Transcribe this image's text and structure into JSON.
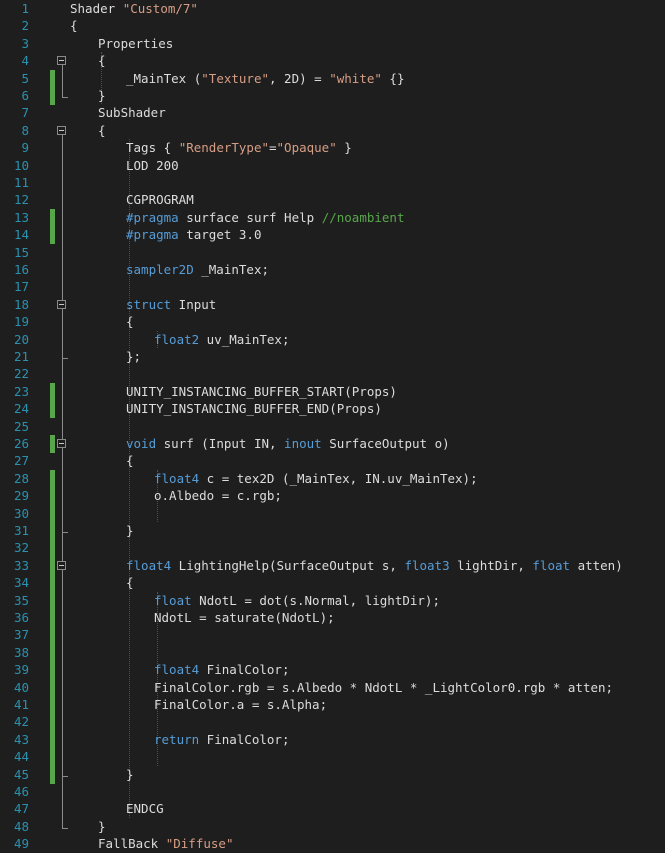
{
  "theme": {
    "background": "#1e1e1e",
    "line_number": "#2b91af",
    "text": "#dcdcdc",
    "keyword": "#569cd6",
    "string": "#d69d85",
    "comment": "#57a64a",
    "change_marker": "#57a64a"
  },
  "icons": {
    "fold": "collapse-minus-icon"
  },
  "lines": [
    {
      "n": "1",
      "changed": false,
      "fold": false,
      "indent": 0,
      "tokens": [
        [
          "txt",
          "Shader "
        ],
        [
          "str",
          "\"Custom/7\""
        ]
      ]
    },
    {
      "n": "2",
      "changed": false,
      "fold": false,
      "indent": 0,
      "tokens": [
        [
          "txt",
          "{"
        ]
      ]
    },
    {
      "n": "3",
      "changed": false,
      "fold": false,
      "indent": 4,
      "tokens": [
        [
          "txt",
          "Properties"
        ]
      ]
    },
    {
      "n": "4",
      "changed": false,
      "fold": true,
      "indent": 4,
      "tokens": [
        [
          "txt",
          "{"
        ]
      ]
    },
    {
      "n": "5",
      "changed": true,
      "fold": false,
      "indent": 8,
      "tokens": [
        [
          "txt",
          "_MainTex ("
        ],
        [
          "str",
          "\"Texture\""
        ],
        [
          "txt",
          ", 2D) = "
        ],
        [
          "str",
          "\"white\""
        ],
        [
          "txt",
          " {}"
        ]
      ]
    },
    {
      "n": "6",
      "changed": true,
      "fold": false,
      "indent": 4,
      "tokens": [
        [
          "txt",
          "}"
        ]
      ]
    },
    {
      "n": "7",
      "changed": false,
      "fold": false,
      "indent": 4,
      "tokens": [
        [
          "txt",
          "SubShader"
        ]
      ]
    },
    {
      "n": "8",
      "changed": false,
      "fold": true,
      "indent": 4,
      "tokens": [
        [
          "txt",
          "{"
        ]
      ]
    },
    {
      "n": "9",
      "changed": false,
      "fold": false,
      "indent": 8,
      "tokens": [
        [
          "txt",
          "Tags { "
        ],
        [
          "str",
          "\"RenderType\""
        ],
        [
          "txt",
          "="
        ],
        [
          "str",
          "\"Opaque\""
        ],
        [
          "txt",
          " }"
        ]
      ]
    },
    {
      "n": "10",
      "changed": false,
      "fold": false,
      "indent": 8,
      "tokens": [
        [
          "txt",
          "LOD 200"
        ]
      ]
    },
    {
      "n": "11",
      "changed": false,
      "fold": false,
      "indent": 0,
      "tokens": []
    },
    {
      "n": "12",
      "changed": false,
      "fold": false,
      "indent": 8,
      "tokens": [
        [
          "txt",
          "CGPROGRAM"
        ]
      ]
    },
    {
      "n": "13",
      "changed": true,
      "fold": false,
      "indent": 8,
      "tokens": [
        [
          "kw",
          "#pragma"
        ],
        [
          "txt",
          " surface surf Help "
        ],
        [
          "com",
          "//noambient"
        ]
      ]
    },
    {
      "n": "14",
      "changed": true,
      "fold": false,
      "indent": 8,
      "tokens": [
        [
          "kw",
          "#pragma"
        ],
        [
          "txt",
          " target 3.0"
        ]
      ]
    },
    {
      "n": "15",
      "changed": false,
      "fold": false,
      "indent": 0,
      "tokens": []
    },
    {
      "n": "16",
      "changed": false,
      "fold": false,
      "indent": 8,
      "tokens": [
        [
          "kw",
          "sampler2D"
        ],
        [
          "txt",
          " _MainTex;"
        ]
      ]
    },
    {
      "n": "17",
      "changed": false,
      "fold": false,
      "indent": 0,
      "tokens": []
    },
    {
      "n": "18",
      "changed": false,
      "fold": true,
      "indent": 8,
      "tokens": [
        [
          "kw",
          "struct"
        ],
        [
          "txt",
          " Input"
        ]
      ]
    },
    {
      "n": "19",
      "changed": false,
      "fold": false,
      "indent": 8,
      "tokens": [
        [
          "txt",
          "{"
        ]
      ]
    },
    {
      "n": "20",
      "changed": false,
      "fold": false,
      "indent": 12,
      "tokens": [
        [
          "kw",
          "float2"
        ],
        [
          "txt",
          " uv_MainTex;"
        ]
      ]
    },
    {
      "n": "21",
      "changed": false,
      "fold": false,
      "indent": 8,
      "tokens": [
        [
          "txt",
          "};"
        ]
      ]
    },
    {
      "n": "22",
      "changed": false,
      "fold": false,
      "indent": 0,
      "tokens": []
    },
    {
      "n": "23",
      "changed": true,
      "fold": false,
      "indent": 8,
      "tokens": [
        [
          "txt",
          "UNITY_INSTANCING_BUFFER_START(Props)"
        ]
      ]
    },
    {
      "n": "24",
      "changed": true,
      "fold": false,
      "indent": 8,
      "tokens": [
        [
          "txt",
          "UNITY_INSTANCING_BUFFER_END(Props)"
        ]
      ]
    },
    {
      "n": "25",
      "changed": false,
      "fold": false,
      "indent": 0,
      "tokens": []
    },
    {
      "n": "26",
      "changed": true,
      "fold": true,
      "indent": 8,
      "tokens": [
        [
          "kw",
          "void"
        ],
        [
          "txt",
          " surf (Input IN, "
        ],
        [
          "kw",
          "inout"
        ],
        [
          "txt",
          " SurfaceOutput o)"
        ]
      ]
    },
    {
      "n": "27",
      "changed": false,
      "fold": false,
      "indent": 8,
      "tokens": [
        [
          "txt",
          "{"
        ]
      ]
    },
    {
      "n": "28",
      "changed": true,
      "fold": false,
      "indent": 12,
      "tokens": [
        [
          "kw",
          "float4"
        ],
        [
          "txt",
          " c = tex2D (_MainTex, IN.uv_MainTex);"
        ]
      ]
    },
    {
      "n": "29",
      "changed": true,
      "fold": false,
      "indent": 12,
      "tokens": [
        [
          "txt",
          "o.Albedo = c.rgb;"
        ]
      ]
    },
    {
      "n": "30",
      "changed": true,
      "fold": false,
      "indent": 0,
      "tokens": []
    },
    {
      "n": "31",
      "changed": true,
      "fold": false,
      "indent": 8,
      "tokens": [
        [
          "txt",
          "}"
        ]
      ]
    },
    {
      "n": "32",
      "changed": true,
      "fold": false,
      "indent": 0,
      "tokens": []
    },
    {
      "n": "33",
      "changed": true,
      "fold": true,
      "indent": 8,
      "tokens": [
        [
          "kw",
          "float4"
        ],
        [
          "txt",
          " LightingHelp(SurfaceOutput s, "
        ],
        [
          "kw",
          "float3"
        ],
        [
          "txt",
          " lightDir, "
        ],
        [
          "kw",
          "float"
        ],
        [
          "txt",
          " atten)"
        ]
      ]
    },
    {
      "n": "34",
      "changed": true,
      "fold": false,
      "indent": 8,
      "tokens": [
        [
          "txt",
          "{"
        ]
      ]
    },
    {
      "n": "35",
      "changed": true,
      "fold": false,
      "indent": 12,
      "tokens": [
        [
          "kw",
          "float"
        ],
        [
          "txt",
          " NdotL = dot(s.Normal, lightDir);"
        ]
      ]
    },
    {
      "n": "36",
      "changed": true,
      "fold": false,
      "indent": 12,
      "tokens": [
        [
          "txt",
          "NdotL = saturate(NdotL);"
        ]
      ]
    },
    {
      "n": "37",
      "changed": true,
      "fold": false,
      "indent": 0,
      "tokens": []
    },
    {
      "n": "38",
      "changed": true,
      "fold": false,
      "indent": 0,
      "tokens": []
    },
    {
      "n": "39",
      "changed": true,
      "fold": false,
      "indent": 12,
      "tokens": [
        [
          "kw",
          "float4"
        ],
        [
          "txt",
          " FinalColor;"
        ]
      ]
    },
    {
      "n": "40",
      "changed": true,
      "fold": false,
      "indent": 12,
      "tokens": [
        [
          "txt",
          "FinalColor.rgb = s.Albedo * NdotL * _LightColor0.rgb * atten;"
        ]
      ]
    },
    {
      "n": "41",
      "changed": true,
      "fold": false,
      "indent": 12,
      "tokens": [
        [
          "txt",
          "FinalColor.a = s.Alpha;"
        ]
      ]
    },
    {
      "n": "42",
      "changed": true,
      "fold": false,
      "indent": 0,
      "tokens": []
    },
    {
      "n": "43",
      "changed": true,
      "fold": false,
      "indent": 12,
      "tokens": [
        [
          "kw",
          "return"
        ],
        [
          "txt",
          " FinalColor;"
        ]
      ]
    },
    {
      "n": "44",
      "changed": true,
      "fold": false,
      "indent": 0,
      "tokens": []
    },
    {
      "n": "45",
      "changed": true,
      "fold": false,
      "indent": 8,
      "tokens": [
        [
          "txt",
          "}"
        ]
      ]
    },
    {
      "n": "46",
      "changed": false,
      "fold": false,
      "indent": 0,
      "tokens": []
    },
    {
      "n": "47",
      "changed": false,
      "fold": false,
      "indent": 8,
      "tokens": [
        [
          "txt",
          "ENDCG"
        ]
      ]
    },
    {
      "n": "48",
      "changed": false,
      "fold": false,
      "indent": 4,
      "tokens": [
        [
          "txt",
          "}"
        ]
      ]
    },
    {
      "n": "49",
      "changed": false,
      "fold": false,
      "indent": 4,
      "tokens": [
        [
          "txt",
          "FallBack "
        ],
        [
          "str",
          "\"Diffuse\""
        ]
      ]
    }
  ]
}
